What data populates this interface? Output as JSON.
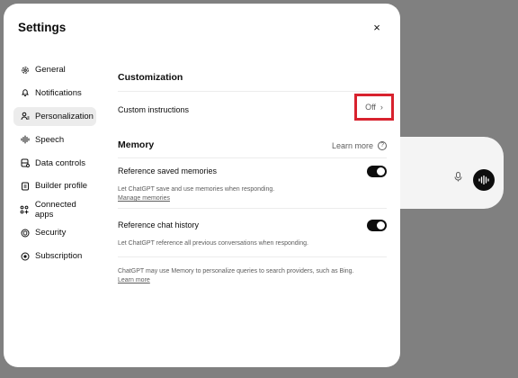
{
  "settings": {
    "title": "Settings",
    "close_icon": "×",
    "sidebar": [
      {
        "label": "General",
        "icon": "gear-icon"
      },
      {
        "label": "Notifications",
        "icon": "bell-icon"
      },
      {
        "label": "Personalization",
        "icon": "person-icon",
        "active": true
      },
      {
        "label": "Speech",
        "icon": "waveform-icon"
      },
      {
        "label": "Data controls",
        "icon": "database-icon"
      },
      {
        "label": "Builder profile",
        "icon": "id-card-icon"
      },
      {
        "label": "Connected apps",
        "icon": "apps-grid-icon"
      },
      {
        "label": "Security",
        "icon": "shield-icon"
      },
      {
        "label": "Subscription",
        "icon": "subscription-icon"
      }
    ],
    "customization": {
      "title": "Customization",
      "custom_instructions_label": "Custom instructions",
      "custom_instructions_value": "Off",
      "chevron": "›"
    },
    "memory": {
      "title": "Memory",
      "learn_more": "Learn more",
      "reference_saved_label": "Reference saved memories",
      "reference_saved_on": true,
      "reference_saved_helper": "Let ChatGPT save and use memories when responding.",
      "manage_memories": "Manage memories",
      "reference_history_label": "Reference chat history",
      "reference_history_on": true,
      "reference_history_helper": "Let ChatGPT reference all previous conversations when responding.",
      "footer_text": "ChatGPT may use Memory to personalize queries to search providers, such as Bing.",
      "footer_link": "Learn more"
    }
  },
  "colors": {
    "highlight_border": "#d8222e",
    "toggle_on": "#0d0d0d",
    "overlay": "#808080"
  }
}
